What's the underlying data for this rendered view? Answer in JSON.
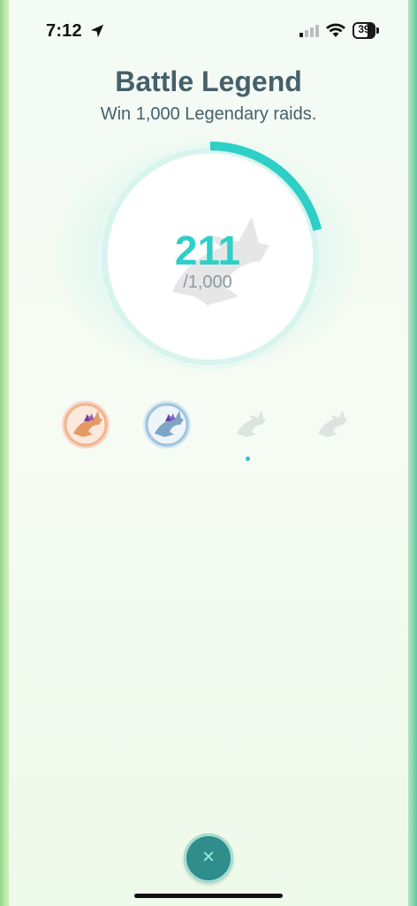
{
  "status_bar": {
    "time": "7:12",
    "battery": "39",
    "icons": [
      "location-arrow-icon",
      "cellular-signal-icon",
      "wifi-icon",
      "battery-icon"
    ]
  },
  "medal": {
    "title": "Battle Legend",
    "description": "Win 1,000 Legendary raids.",
    "current": "211",
    "goal": "/1,000",
    "progress_fraction": 0.211,
    "accent_color": "#2ecfc7",
    "tiers": [
      {
        "tier": "bronze",
        "achieved": true,
        "color": "#f2b48c"
      },
      {
        "tier": "silver",
        "achieved": true,
        "color": "#9fc4de"
      },
      {
        "tier": "gold",
        "achieved": false
      },
      {
        "tier": "platinum",
        "achieved": false
      }
    ],
    "selected_tier": 2
  },
  "close": {
    "label": "×"
  }
}
